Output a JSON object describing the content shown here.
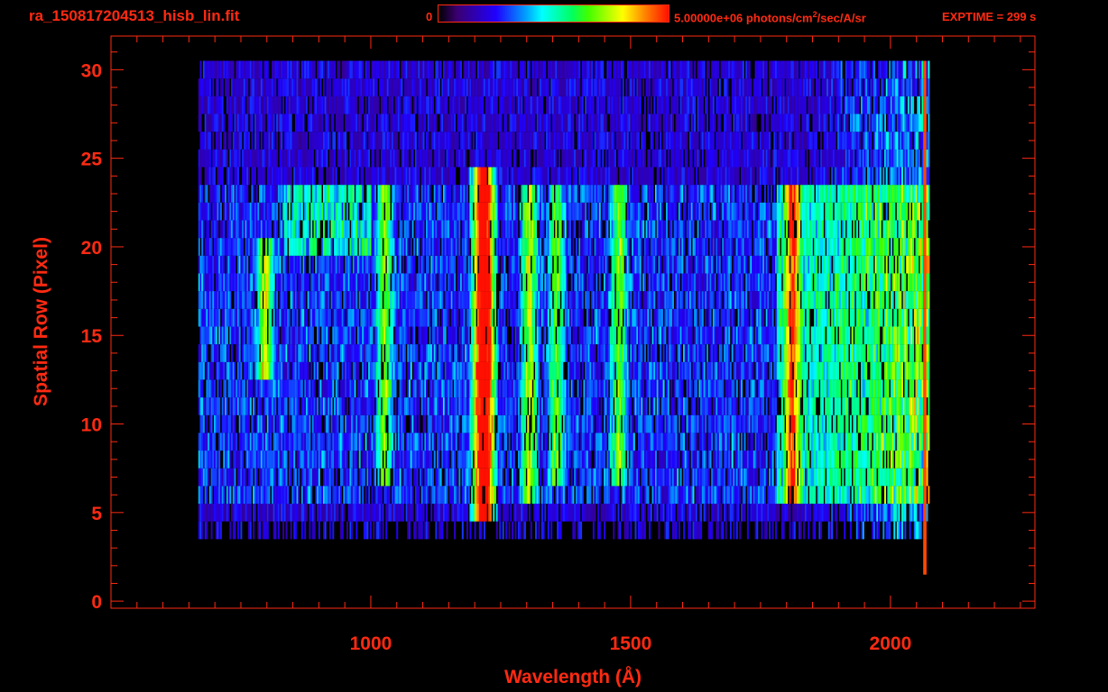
{
  "header": {
    "title": "ra_150817204513_hisb_lin.fit",
    "colorbar_min": "0",
    "colorbar_max": "5.00000e+06 photons/cm",
    "colorbar_max_sup": "2",
    "colorbar_max_tail": "/sec/A/sr",
    "exptime": "EXPTIME = 299 s"
  },
  "chart_data": {
    "type": "heatmap",
    "title": "ra_150817204513_hisb_lin.fit",
    "xlabel": "Wavelength (Å)",
    "ylabel": "Spatial Row (Pixel)",
    "xlim": [
      500,
      2278
    ],
    "ylim": [
      -0.4,
      31.9
    ],
    "x_ticks": [
      1000,
      1500,
      2000
    ],
    "x_tick_labels": [
      "1000",
      "1500",
      "2000"
    ],
    "y_ticks": [
      0,
      5,
      10,
      15,
      20,
      25,
      30
    ],
    "y_tick_labels": [
      "0",
      "5",
      "10",
      "15",
      "20",
      "25",
      "30"
    ],
    "colorbar_range": [
      0,
      5000000
    ],
    "colormap": "rainbow",
    "detector_wavelength_range": [
      668,
      2075
    ],
    "illuminated_rows": [
      5,
      24
    ],
    "emission_features": [
      {
        "wavelength": 1025,
        "rows": [
          7,
          23
        ],
        "peak": 0.45
      },
      {
        "wavelength": 1216,
        "rows": [
          5,
          24
        ],
        "peak": 1.0
      },
      {
        "wavelength": 1304,
        "rows": [
          6,
          23
        ],
        "peak": 0.5
      },
      {
        "wavelength": 1356,
        "rows": [
          7,
          23
        ],
        "peak": 0.38
      },
      {
        "wavelength": 1476,
        "rows": [
          7,
          23
        ],
        "peak": 0.42
      },
      {
        "wavelength": 1810,
        "rows": [
          6,
          23
        ],
        "peak": 0.55
      },
      {
        "wavelength": 795,
        "rows": [
          13,
          20
        ],
        "peak": 0.55
      }
    ],
    "colors": {
      "axis": "#ff2a12",
      "background": "#000000"
    }
  }
}
